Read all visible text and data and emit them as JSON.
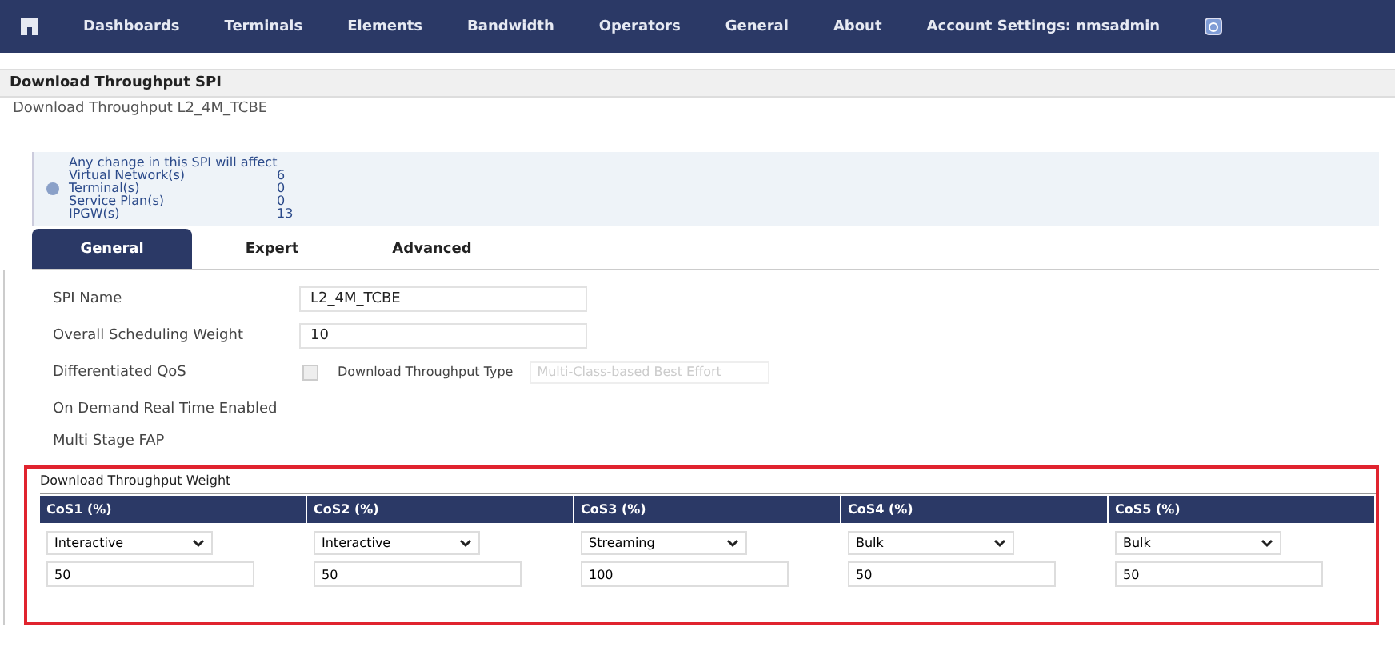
{
  "nav": {
    "items": [
      {
        "label": "Dashboards"
      },
      {
        "label": "Terminals"
      },
      {
        "label": "Elements"
      },
      {
        "label": "Bandwidth"
      },
      {
        "label": "Operators"
      },
      {
        "label": "General"
      },
      {
        "label": "About"
      },
      {
        "label": "Account Settings: nmsadmin"
      }
    ]
  },
  "header": {
    "title": "Download Throughput SPI",
    "subtitle": "Download Throughput L2_4M_TCBE"
  },
  "notice": {
    "heading": "Any change in this SPI will affect",
    "rows": [
      {
        "label": "Virtual Network(s)",
        "count": "6"
      },
      {
        "label": "Terminal(s)",
        "count": "0"
      },
      {
        "label": "Service Plan(s)",
        "count": "0"
      },
      {
        "label": "IPGW(s)",
        "count": "13"
      }
    ]
  },
  "tabs": [
    {
      "label": "General",
      "selected": true
    },
    {
      "label": "Expert",
      "selected": false
    },
    {
      "label": "Advanced",
      "selected": false
    }
  ],
  "form": {
    "spi_name": {
      "label": "SPI Name",
      "value": "L2_4M_TCBE"
    },
    "weight": {
      "label": "Overall Scheduling Weight",
      "value": "10"
    },
    "qos": {
      "label": "Differentiated QoS",
      "checked": false,
      "type_label": "Download Throughput Type",
      "type_value": "Multi-Class-based Best Effort"
    },
    "on_demand": {
      "label": "On Demand Real Time Enabled"
    },
    "multi_stage": {
      "label": "Multi Stage FAP"
    }
  },
  "weights": {
    "title": "Download Throughput Weight",
    "columns": [
      {
        "header": "CoS1 (%)",
        "class": "Interactive",
        "value": "50"
      },
      {
        "header": "CoS2 (%)",
        "class": "Interactive",
        "value": "50"
      },
      {
        "header": "CoS3 (%)",
        "class": "Streaming",
        "value": "100"
      },
      {
        "header": "CoS4 (%)",
        "class": "Bulk",
        "value": "50"
      },
      {
        "header": "CoS5 (%)",
        "class": "Bulk",
        "value": "50"
      }
    ]
  }
}
